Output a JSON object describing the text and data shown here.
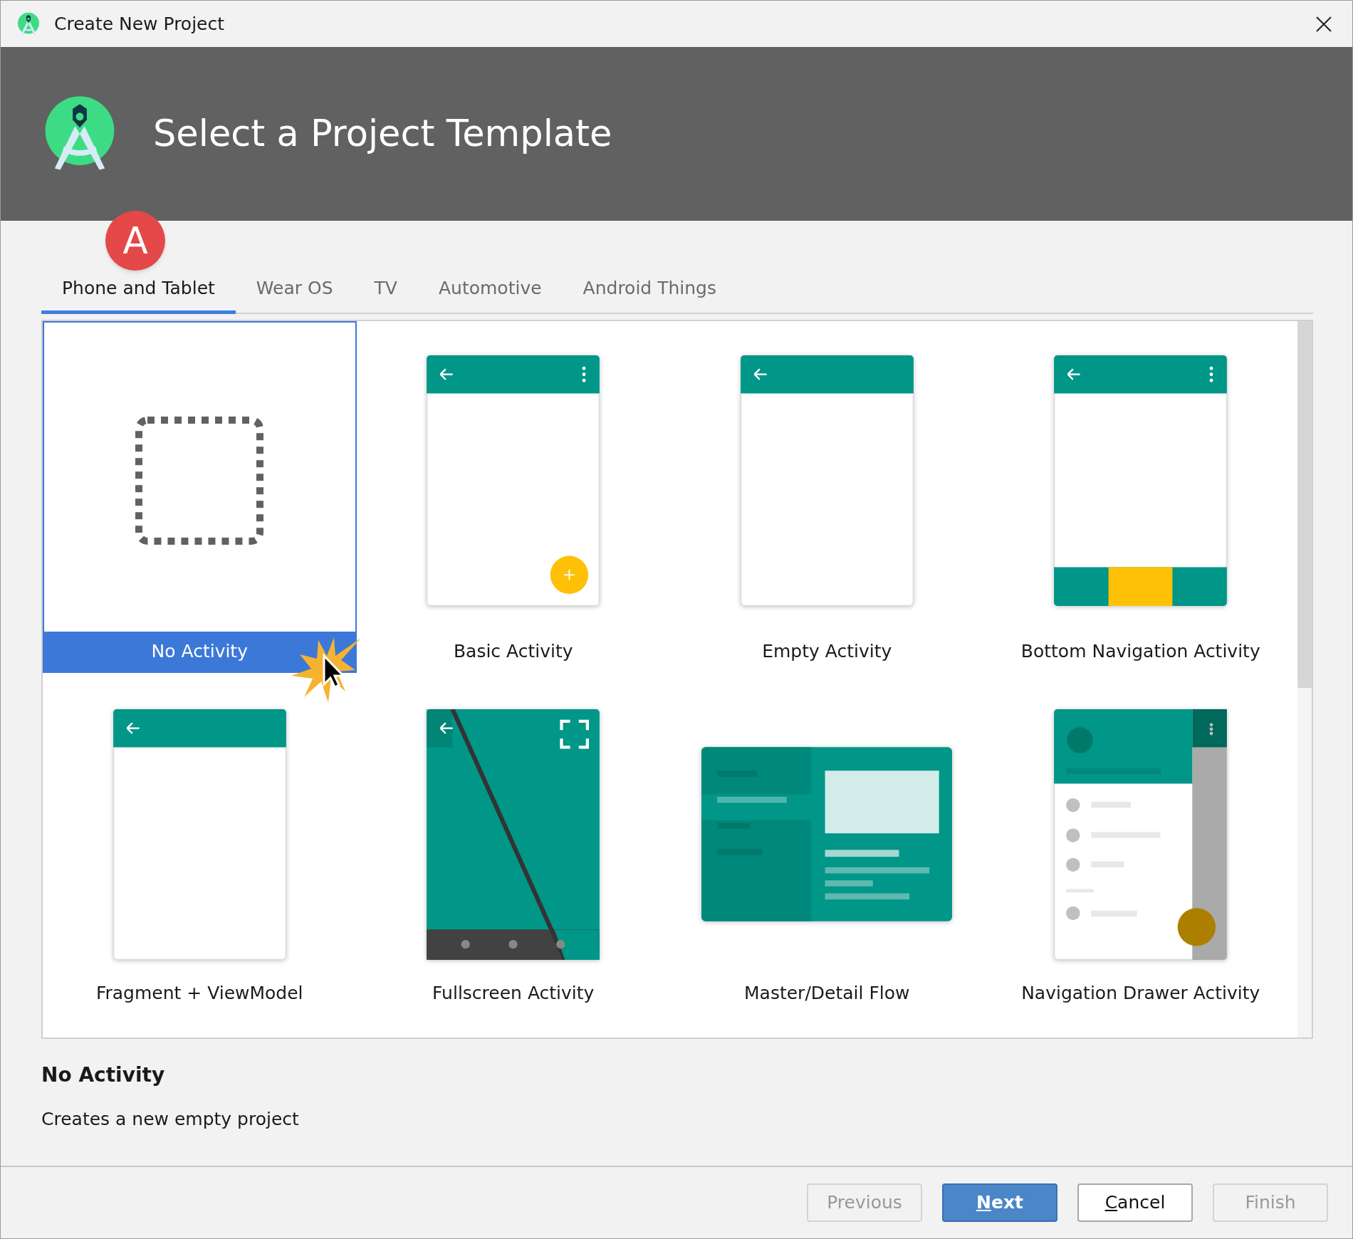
{
  "window": {
    "title": "Create New Project"
  },
  "header": {
    "title": "Select a Project Template"
  },
  "step_badge": "A",
  "tabs": [
    {
      "label": "Phone and Tablet",
      "selected": true
    },
    {
      "label": "Wear OS",
      "selected": false
    },
    {
      "label": "TV",
      "selected": false
    },
    {
      "label": "Automotive",
      "selected": false
    },
    {
      "label": "Android Things",
      "selected": false
    }
  ],
  "templates": [
    {
      "label": "No Activity",
      "kind": "blank",
      "selected": true
    },
    {
      "label": "Basic Activity",
      "kind": "basic",
      "selected": false
    },
    {
      "label": "Empty Activity",
      "kind": "empty",
      "selected": false
    },
    {
      "label": "Bottom Navigation Activity",
      "kind": "bottom_nav",
      "selected": false
    },
    {
      "label": "Fragment + ViewModel",
      "kind": "fragment",
      "selected": false
    },
    {
      "label": "Fullscreen Activity",
      "kind": "fullscreen",
      "selected": false
    },
    {
      "label": "Master/Detail Flow",
      "kind": "master_detail",
      "selected": false
    },
    {
      "label": "Navigation Drawer Activity",
      "kind": "nav_drawer",
      "selected": false
    }
  ],
  "description": {
    "title": "No Activity",
    "text": "Creates a new empty project"
  },
  "buttons": [
    {
      "label": "Previous",
      "kind": "normal",
      "disabled": true,
      "mnemonic": false
    },
    {
      "label": "Next",
      "kind": "primary",
      "disabled": false,
      "mnemonic": true
    },
    {
      "label": "Cancel",
      "kind": "normal",
      "disabled": false,
      "mnemonic": true
    },
    {
      "label": "Finish",
      "kind": "normal",
      "disabled": true,
      "mnemonic": false
    }
  ]
}
